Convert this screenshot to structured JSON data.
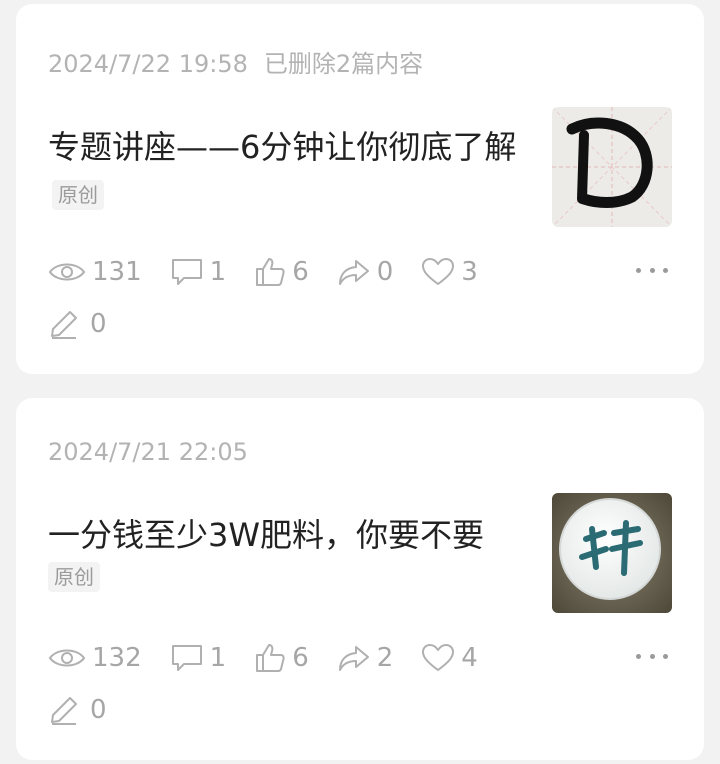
{
  "posts": [
    {
      "timestamp": "2024/7/22 19:58",
      "note": "已删除2篇内容",
      "title": "专题讲座——6分钟让你彻底了解",
      "badge": "原创",
      "thumbnail_icon": "handwritten-d-thumbnail",
      "stats": {
        "views": "131",
        "comments": "1",
        "likes": "6",
        "shares": "0",
        "favorites": "3",
        "edits": "0"
      }
    },
    {
      "timestamp": "2024/7/21 22:05",
      "title": "一分钱至少3W肥料，你要不要",
      "badge": "原创",
      "thumbnail_icon": "round-chip-thumbnail",
      "stats": {
        "views": "132",
        "comments": "1",
        "likes": "6",
        "shares": "2",
        "favorites": "4",
        "edits": "0"
      }
    }
  ],
  "colors": {
    "background": "#f2f2f2",
    "card": "#ffffff",
    "meta_text": "#b3b3b3",
    "title_text": "#222222",
    "stat_text": "#a6a6a6"
  }
}
